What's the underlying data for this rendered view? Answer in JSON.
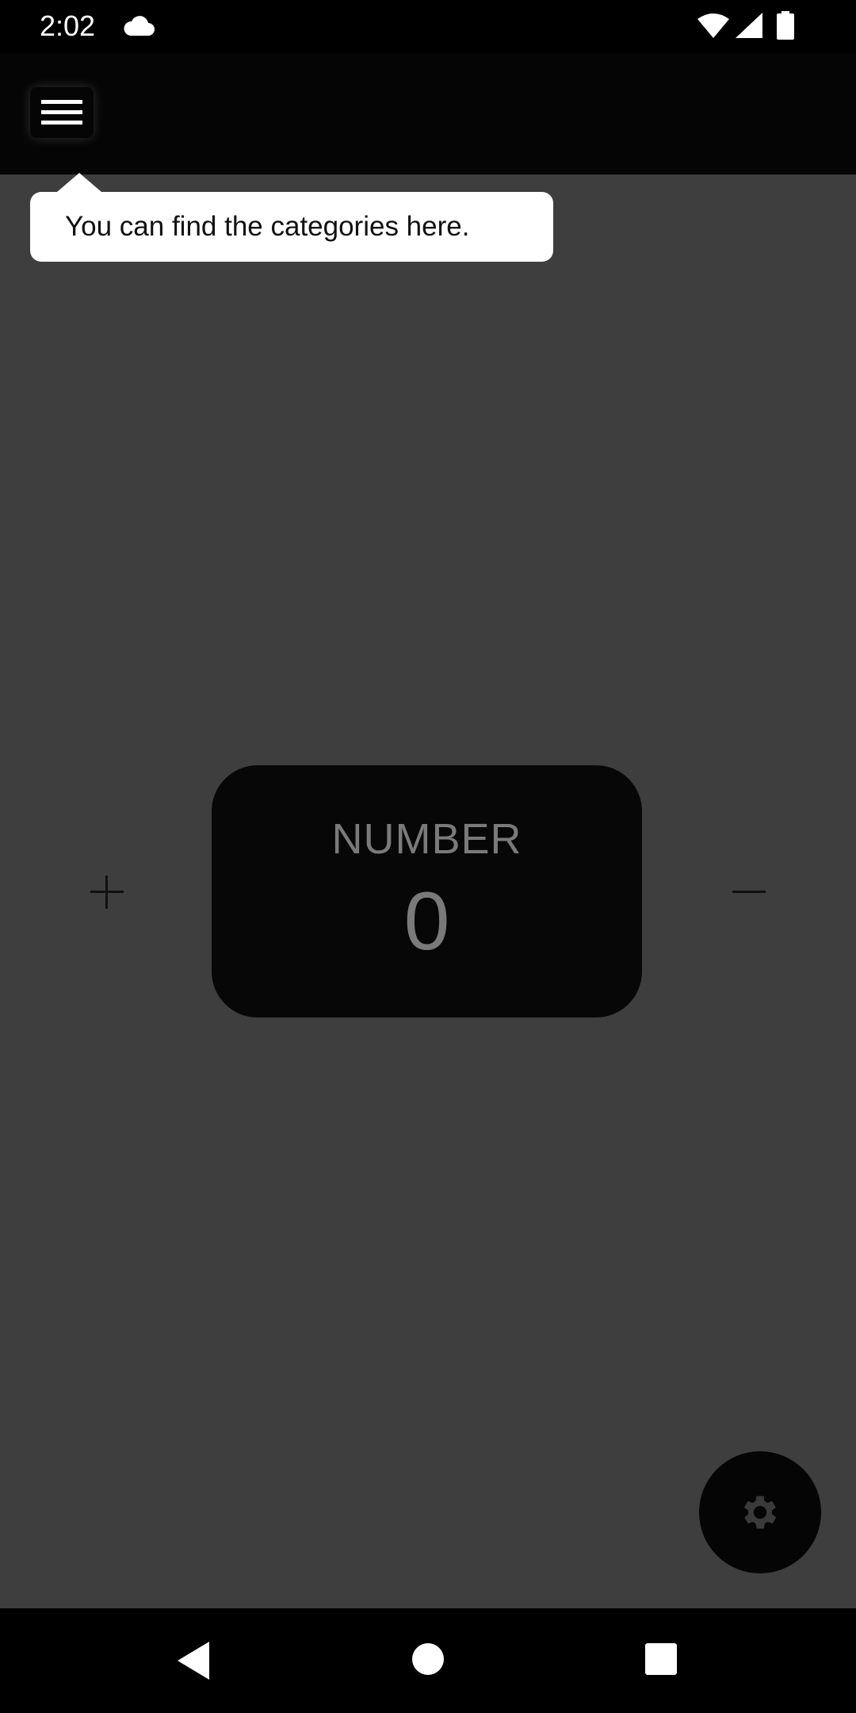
{
  "status_bar": {
    "time": "2:02",
    "icons": [
      "cloud-icon",
      "wifi-icon",
      "signal-icon",
      "battery-icon"
    ]
  },
  "app_bar": {
    "menu_icon": "hamburger-menu-icon"
  },
  "tooltip": {
    "text": "You can find the categories here."
  },
  "counter": {
    "label": "NUMBER",
    "value": "0",
    "increment_symbol": "+",
    "decrement_symbol": "−"
  },
  "fab": {
    "icon": "gear-icon"
  },
  "nav_bar": {
    "icons": [
      "back-icon",
      "home-icon",
      "recents-icon"
    ]
  },
  "colors": {
    "background_overlay": "#3e3e3e",
    "card": "#070707",
    "tooltip_bg": "#ffffff",
    "muted_text": "#7a7a7a"
  }
}
